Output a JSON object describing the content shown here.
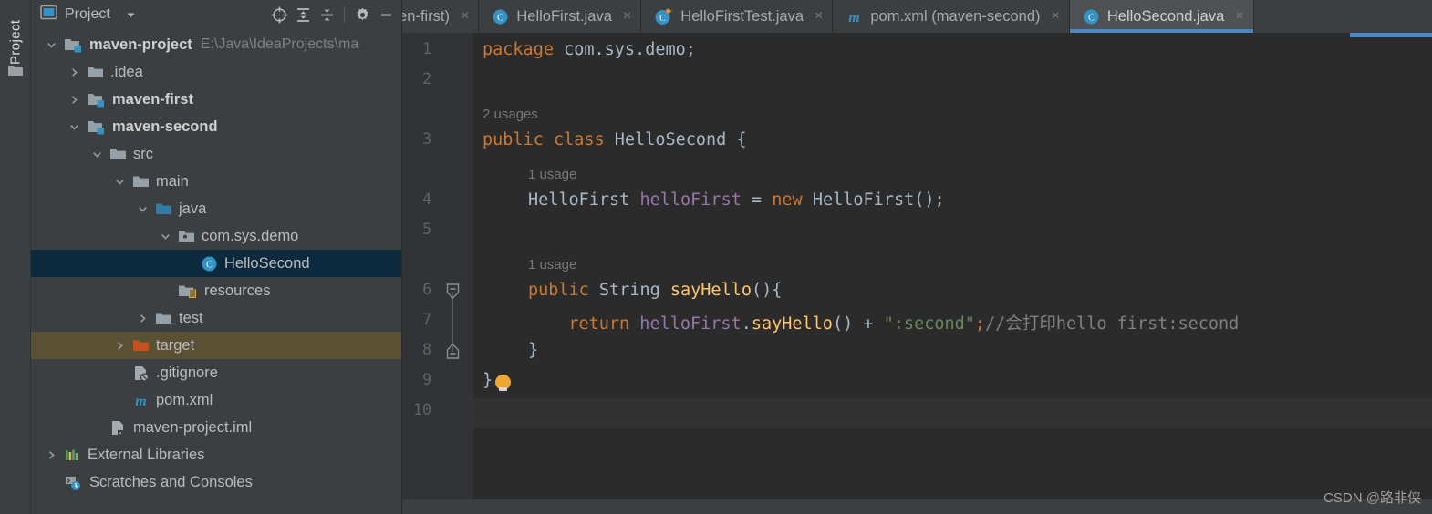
{
  "toolwindow": {
    "vertical_label": "Project",
    "folder_icon": "folder-icon"
  },
  "panel": {
    "title": "Project",
    "dropdown_icon": "chevron-down-icon",
    "buttons": [
      {
        "name": "select-opened-file-icon",
        "label": "locate-target-icon"
      },
      {
        "name": "expand-all-icon",
        "label": "expand-all-icon"
      },
      {
        "name": "collapse-all-icon",
        "label": "collapse-all-icon"
      },
      {
        "name": "settings-icon",
        "label": "gear-icon"
      },
      {
        "name": "hide-icon",
        "label": "minimize-icon"
      }
    ]
  },
  "tree": [
    {
      "label": "maven-project",
      "sublabel": "E:\\Java\\IdeaProjects\\ma",
      "indent": 0,
      "arrow": "down",
      "icon": "module-folder-icon",
      "bold": true,
      "state": "normal"
    },
    {
      "label": ".idea",
      "sublabel": "",
      "indent": 1,
      "arrow": "right",
      "icon": "folder-icon",
      "bold": false,
      "state": "normal"
    },
    {
      "label": "maven-first",
      "sublabel": "",
      "indent": 1,
      "arrow": "right",
      "icon": "module-folder-icon",
      "bold": true,
      "state": "normal"
    },
    {
      "label": "maven-second",
      "sublabel": "",
      "indent": 1,
      "arrow": "down",
      "icon": "module-folder-icon",
      "bold": true,
      "state": "normal"
    },
    {
      "label": "src",
      "sublabel": "",
      "indent": 2,
      "arrow": "down",
      "icon": "folder-icon",
      "bold": false,
      "state": "normal"
    },
    {
      "label": "main",
      "sublabel": "",
      "indent": 3,
      "arrow": "down",
      "icon": "folder-icon",
      "bold": false,
      "state": "normal"
    },
    {
      "label": "java",
      "sublabel": "",
      "indent": 4,
      "arrow": "down",
      "icon": "source-folder-icon",
      "bold": false,
      "state": "normal"
    },
    {
      "label": "com.sys.demo",
      "sublabel": "",
      "indent": 5,
      "arrow": "down",
      "icon": "package-folder-icon",
      "bold": false,
      "state": "normal"
    },
    {
      "label": "HelloSecond",
      "sublabel": "",
      "indent": 6,
      "arrow": "none",
      "icon": "java-class-icon",
      "bold": false,
      "state": "selected"
    },
    {
      "label": "resources",
      "sublabel": "",
      "indent": 5,
      "arrow": "none",
      "icon": "resources-folder-icon",
      "bold": false,
      "state": "normal"
    },
    {
      "label": "test",
      "sublabel": "",
      "indent": 4,
      "arrow": "right",
      "icon": "folder-icon",
      "bold": false,
      "state": "normal"
    },
    {
      "label": "target",
      "sublabel": "",
      "indent": 3,
      "arrow": "right",
      "icon": "excluded-folder-icon",
      "bold": false,
      "state": "marked"
    },
    {
      "label": ".gitignore",
      "sublabel": "",
      "indent": 3,
      "arrow": "none",
      "icon": "gitignore-file-icon",
      "bold": false,
      "state": "normal"
    },
    {
      "label": "pom.xml",
      "sublabel": "",
      "indent": 3,
      "arrow": "none",
      "icon": "maven-file-icon",
      "bold": false,
      "state": "normal"
    },
    {
      "label": "maven-project.iml",
      "sublabel": "",
      "indent": 2,
      "arrow": "none",
      "icon": "iml-file-icon",
      "bold": false,
      "state": "normal"
    },
    {
      "label": "External Libraries",
      "sublabel": "",
      "indent": 0,
      "arrow": "right",
      "icon": "libraries-icon",
      "bold": false,
      "state": "normal"
    },
    {
      "label": "Scratches and Consoles",
      "sublabel": "",
      "indent": 0,
      "arrow": "none",
      "icon": "scratches-icon",
      "bold": false,
      "state": "normal"
    }
  ],
  "tabs": [
    {
      "label": "nl (maven-first)",
      "icon": "none",
      "active": false,
      "truncated": true
    },
    {
      "label": "HelloFirst.java",
      "icon": "java-class-icon",
      "active": false,
      "truncated": false
    },
    {
      "label": "HelloFirstTest.java",
      "icon": "java-test-class-icon",
      "active": false,
      "truncated": false
    },
    {
      "label": "pom.xml (maven-second)",
      "icon": "maven-file-icon",
      "active": false,
      "truncated": false
    },
    {
      "label": "HelloSecond.java",
      "icon": "java-class-icon",
      "active": true,
      "truncated": false
    }
  ],
  "tab_close_glyph": "×",
  "editor": {
    "line_numbers": [
      "1",
      "2",
      "3",
      "4",
      "5",
      "6",
      "7",
      "8",
      "9",
      "10"
    ],
    "current_line": "10",
    "inlay_hints": [
      {
        "text": "2 usages",
        "line_above": "3"
      },
      {
        "text": "1 usage",
        "line_above": "4"
      },
      {
        "text": "1 usage",
        "line_above": "6"
      }
    ],
    "code_lines": [
      {
        "num": "1",
        "text": "package com.sys.demo;"
      },
      {
        "num": "2",
        "text": ""
      },
      {
        "num": "3",
        "text": "public class HelloSecond {"
      },
      {
        "num": "4",
        "text": "    HelloFirst helloFirst = new HelloFirst();"
      },
      {
        "num": "5",
        "text": ""
      },
      {
        "num": "6",
        "text": "    public String sayHello(){"
      },
      {
        "num": "7",
        "text": "        return helloFirst.sayHello() + \":second\";//会打印hello first:second"
      },
      {
        "num": "8",
        "text": "    }"
      },
      {
        "num": "9",
        "text": "}"
      },
      {
        "num": "10",
        "text": ""
      }
    ],
    "tokens": {
      "l1_kw": "package",
      "l1_pkg": " com.sys.demo;",
      "l3_kw": "public class",
      "l3_name": " HelloSecond {",
      "l4_type": "HelloFirst ",
      "l4_field": "helloFirst",
      "l4_eq": " = ",
      "l4_new": "new",
      "l4_ctor": " HelloFirst();",
      "l6_kw": "public",
      "l6_type": " String ",
      "l6_mth": "sayHello",
      "l6_tail": "(){",
      "l7_kw": "return",
      "l7_field": " helloFirst",
      "l7_dot": ".",
      "l7_mth": "sayHello",
      "l7_paren": "() + ",
      "l7_str": "\":second\"",
      "l7_semi": ";",
      "l7_cmt": "//会打印hello first:second",
      "l8_brace": "}",
      "l9_brace": "}"
    },
    "bulb_icon": "intention-bulb-icon",
    "fold_markers": [
      "6",
      "8"
    ]
  },
  "watermark": "CSDN @路非侠",
  "colors": {
    "panel_bg": "#3c3f41",
    "editor_bg": "#2b2b2b",
    "gutter_bg": "#313335",
    "selection": "#0d293e",
    "marked_row": "#5a5034",
    "accent": "#4a88c7",
    "keyword": "#cc7832",
    "string": "#6a8759",
    "field": "#9876aa",
    "method": "#ffc66d",
    "comment": "#808080",
    "text": "#a9b7c6"
  }
}
